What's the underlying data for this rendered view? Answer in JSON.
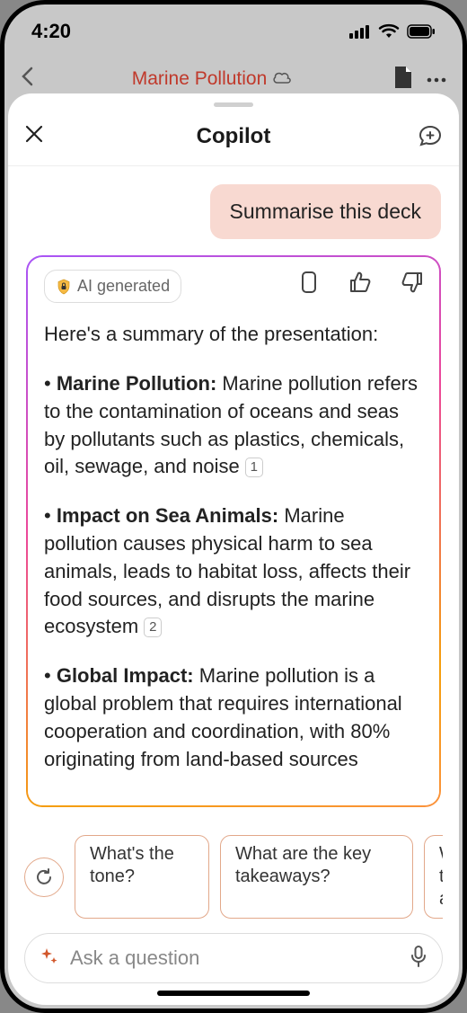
{
  "status": {
    "time": "4:20"
  },
  "behind": {
    "title": "Marine Pollution"
  },
  "sheet": {
    "title": "Copilot",
    "user_prompt": "Summarise this deck",
    "ai_badge": "AI generated",
    "summary_intro": "Here's a summary of the presentation:",
    "bullets": [
      {
        "label": "Marine Pollution:",
        "text": " Marine pollution refers to the contamination of oceans and seas by pollutants such as plastics, chemicals, oil, sewage, and noise ",
        "cite": "1"
      },
      {
        "label": "Impact on Sea Animals:",
        "text": " Marine pollution causes physical harm to sea animals, leads to habitat loss, affects their food sources, and disrupts the marine ecosystem ",
        "cite": "2"
      },
      {
        "label": "Global Impact:",
        "text": " Marine pollution is a global problem that requires international cooperation and coordination, with 80% originating from land-based sources ",
        "cite": ""
      }
    ],
    "suggestions": [
      "What's the tone?",
      "What are the key takeaways?",
      "Who's the audience?"
    ],
    "input_placeholder": "Ask a question"
  }
}
